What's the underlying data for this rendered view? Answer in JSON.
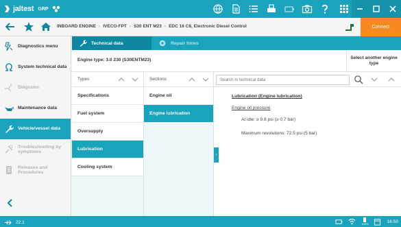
{
  "app": {
    "logo_text": "jaltest",
    "logo_sub": "GRP"
  },
  "breadcrumb": [
    "INBOARD ENGINE",
    "IVECO-FPT",
    "S30 ENT M23",
    "EDC 16 C8, Electronic Diesel Control"
  ],
  "connect_label": "Connect",
  "sidebar": {
    "items": [
      {
        "label": "Diagnostics menu",
        "state": "normal",
        "icon": "diagnostics-icon"
      },
      {
        "label": "System technical data",
        "state": "normal",
        "icon": "omega-icon"
      },
      {
        "label": "Diagrams",
        "state": "disabled",
        "icon": "diagrams-icon"
      },
      {
        "label": "Maintenance data",
        "state": "normal",
        "icon": "oil-can-icon"
      },
      {
        "label": "Vehicle/vessel data",
        "state": "active",
        "icon": "wrench-icon"
      },
      {
        "label": "Troubleshooting by symptoms",
        "state": "disabled",
        "icon": "troubleshooting-icon"
      },
      {
        "label": "Releases and Procedures",
        "state": "disabled",
        "icon": "releases-icon"
      }
    ]
  },
  "tabs": [
    {
      "label": "Technical data",
      "active": true
    },
    {
      "label": "Repair times",
      "active": false
    }
  ],
  "engine_type": "Engine type:  3.0 230 (S30ENTM23)",
  "select_another": "Select another engine type",
  "columns": {
    "types_header": "Types",
    "sections_header": "Sections"
  },
  "search": {
    "placeholder": "Search in technical data",
    "value": ""
  },
  "types": [
    {
      "label": "Specifications",
      "active": false
    },
    {
      "label": "Fuel system",
      "active": false
    },
    {
      "label": "Oversupply",
      "active": false
    },
    {
      "label": "Lubrication",
      "active": true
    },
    {
      "label": "Cooling system",
      "active": false
    }
  ],
  "sections": [
    {
      "label": "Engine oil",
      "active": false
    },
    {
      "label": "Engine lubrication",
      "active": true
    }
  ],
  "content": {
    "title": "Lubrication (Engine lubrication)",
    "subtitle": "Engine oil pressure",
    "lines": [
      "At idle: ≥ 9.8 psi (≥ 0,7 bar)",
      "Maximum revolutions: 72.5 psi (5 bar)"
    ]
  },
  "status": {
    "version": "22.1",
    "battery": "100%",
    "time": "16:50"
  },
  "colors": {
    "accent": "#1aa3bd",
    "connect": "#f6891f"
  }
}
